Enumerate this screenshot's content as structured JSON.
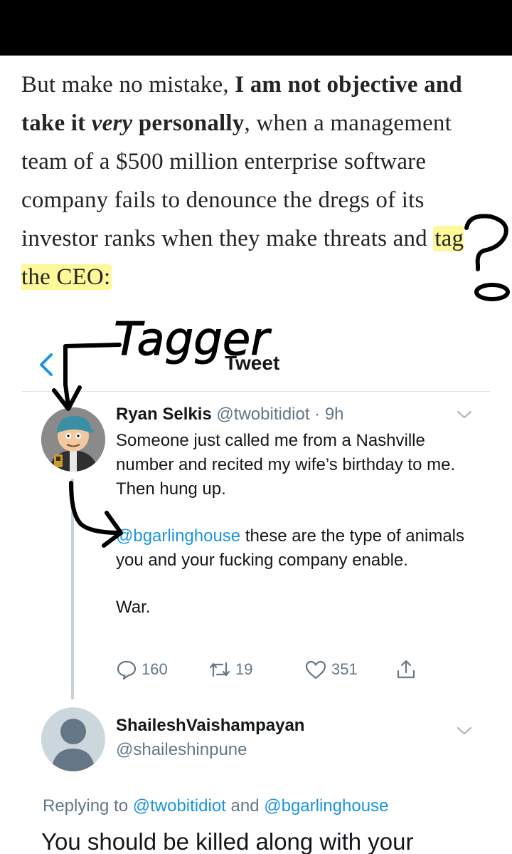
{
  "article": {
    "p1": "But make no mistake, ",
    "bold1": "I am not objective and take it ",
    "italic1": "very",
    "bold2": " personally",
    "p2": ", when a management team of a $500 million enterprise software company fails to denounce the dregs of its investor ranks when they make threats and ",
    "highlight": "tag the CEO:"
  },
  "annotations": {
    "tagger_label": "Tagger",
    "question_mark": "?"
  },
  "tweet_header": {
    "title": "Tweet"
  },
  "tweet": {
    "author_name": "Ryan Selkis",
    "author_handle": "@twobitidiot · 9h",
    "line1": "Someone just called me from a Nashville number and recited my wife’s birthday to me. Then hung up.",
    "mention": "@bgarlinghouse",
    "line2": " these are the type of animals you and your fucking company enable.",
    "line3": "War.",
    "replies": "160",
    "retweets": "19",
    "likes": "351"
  },
  "reply": {
    "name": "ShaileshVaishampayan",
    "handle": "@shaileshinpune",
    "replying_prefix": "Replying to ",
    "replying_to_1": "@twobitidiot",
    "replying_and": " and ",
    "replying_to_2": "@bgarlinghouse",
    "text": "You should be killed along with your"
  },
  "colors": {
    "link_blue": "#1b95e0",
    "secondary_gray": "#657786",
    "highlight_yellow": "#fcf578"
  }
}
